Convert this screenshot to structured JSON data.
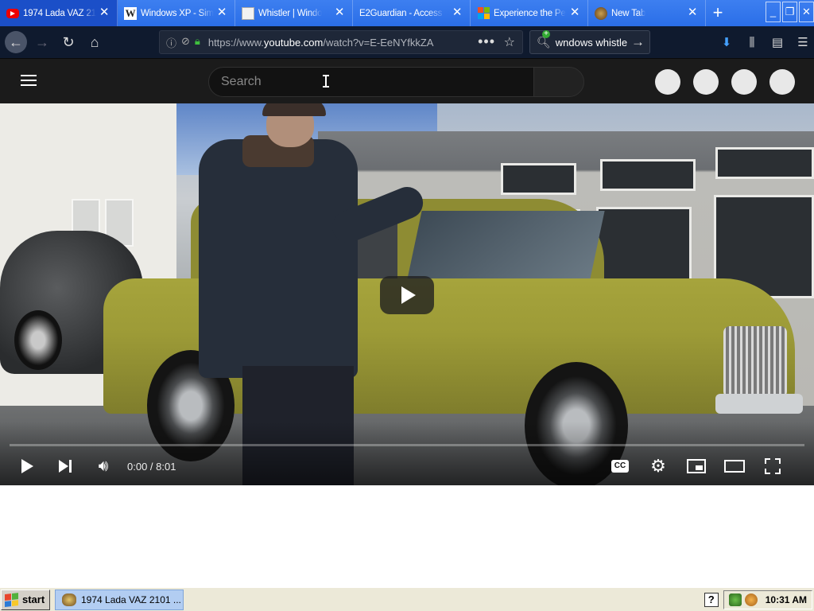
{
  "tabs": [
    {
      "title": "1974 Lada VAZ 21",
      "favicon": "youtube-icon",
      "active": true
    },
    {
      "title": "Windows XP - Sim",
      "favicon": "wikipedia-icon",
      "active": false
    },
    {
      "title": "Whistler | Windo",
      "favicon": "page-icon",
      "active": false
    },
    {
      "title": "E2Guardian - Access D",
      "favicon": "none",
      "active": false
    },
    {
      "title": "Experience the Pe",
      "favicon": "microsoft-icon",
      "active": false
    },
    {
      "title": "New Tab",
      "favicon": "raccoon-icon",
      "active": false
    }
  ],
  "new_tab_label": "+",
  "navbar": {
    "url_prefix": "https://www.",
    "url_domain": "youtube.com",
    "url_path": "/watch?v=E-EeNYfkkZA",
    "search_query": "wndows whistle"
  },
  "youtube": {
    "search_placeholder": "Search"
  },
  "player": {
    "time": "0:00 / 8:01",
    "progress": 0.0,
    "cc_label": "CC"
  },
  "taskbar": {
    "start_label": "start",
    "task_label": "1974 Lada VAZ 2101 ...",
    "clock": "10:31 AM",
    "help_label": "?"
  },
  "colors": {
    "tabstrip": "#2a6ee8",
    "active_tab": "#1b4fc8",
    "navbar": "#0f1a2e",
    "youtube_header": "#1b1b1b",
    "progress_played": "#ff0000",
    "taskbar": "#ece9d8"
  }
}
